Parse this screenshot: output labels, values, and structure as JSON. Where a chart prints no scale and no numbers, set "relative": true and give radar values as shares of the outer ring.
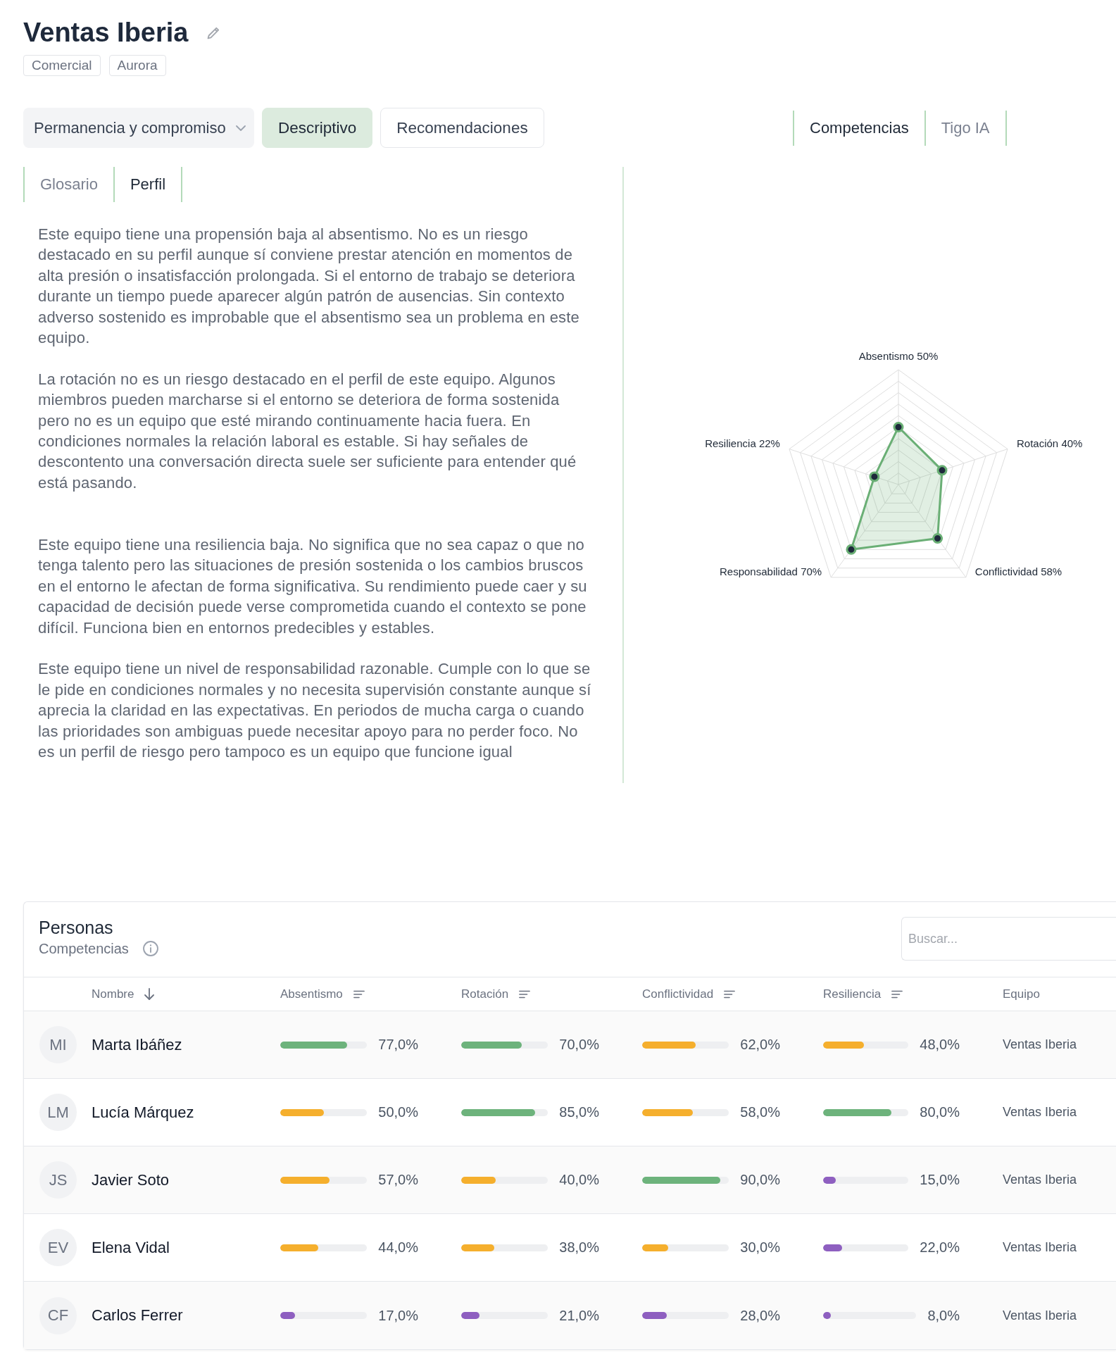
{
  "header": {
    "title": "Ventas Iberia",
    "tags": [
      "Comercial",
      "Aurora"
    ]
  },
  "toolbar": {
    "dropdown": {
      "value": "Permanencia y compromiso"
    },
    "view_buttons": [
      {
        "label": "Descriptivo",
        "selected": true
      },
      {
        "label": "Recomendaciones",
        "selected": false
      }
    ]
  },
  "right_tabs": [
    {
      "label": "Competencias",
      "selected": true
    },
    {
      "label": "Tigo IA",
      "selected": false
    }
  ],
  "sub_tabs": [
    {
      "label": "Glosario",
      "selected": false
    },
    {
      "label": "Perfil",
      "selected": true
    }
  ],
  "description": {
    "paragraphs": [
      "Este equipo tiene una propensión baja al absentismo. No es un riesgo destacado en su perfil aunque sí conviene prestar atención en momentos de alta presión o insatisfacción prolongada. Si el entorno de trabajo se deteriora durante un tiempo puede aparecer algún patrón de ausencias. Sin contexto adverso sostenido es improbable que el absentismo sea un problema en este equipo.",
      "La rotación no es un riesgo destacado en el perfil de este equipo. Algunos miembros pueden marcharse si el entorno se deteriora de forma sostenida pero no es un equipo que esté mirando continuamente hacia fuera. En condiciones normales la relación laboral es estable. Si hay señales de descontento una conversación directa suele ser suficiente para entender qué está pasando.",
      "Este equipo tiene una resiliencia baja. No significa que no sea capaz o que no tenga talento pero las situaciones de presión sostenida o los cambios bruscos en el entorno le afectan de forma significativa. Su rendimiento puede caer y su capacidad de decisión puede verse comprometida cuando el contexto se pone difícil. Funciona bien en entornos predecibles y estables.",
      "Este equipo tiene un nivel de responsabilidad razonable. Cumple con lo que se le pide en condiciones normales y no necesita supervisión constante aunque sí aprecia la claridad en las expectativas. En periodos de mucha carga o cuando las prioridades son ambiguas puede necesitar apoyo para no perder foco. No es un perfil de riesgo pero tampoco es un equipo que funcione igual"
    ]
  },
  "radar": {
    "chart_data": {
      "type": "radar",
      "categories": [
        "Absentismo",
        "Rotación",
        "Conflictividad",
        "Responsabilidad",
        "Resiliencia"
      ],
      "series": [
        {
          "color": "#6aaf75",
          "values": [
            0.5,
            0.4,
            0.58,
            0.7,
            0.22
          ]
        }
      ],
      "ylim": [
        0,
        1
      ],
      "relative": true,
      "value_labels": [
        "50%",
        "40%",
        "58%",
        "70%",
        "22%"
      ]
    }
  },
  "people": {
    "title": "Personas",
    "subtitle": "Competencias",
    "search": {
      "placeholder": "Buscar..."
    },
    "columns": [
      {
        "label": "Nombre",
        "kind": "sorted"
      },
      {
        "label": "Absentismo",
        "kind": "sortable"
      },
      {
        "label": "Rotación",
        "kind": "sortable"
      },
      {
        "label": "Conflictividad",
        "kind": "sortable"
      },
      {
        "label": "Resiliencia",
        "kind": "sortable"
      },
      {
        "label": "Equipo",
        "kind": "plain"
      }
    ],
    "rows": [
      {
        "initials": "MI",
        "name": "Marta Ibáñez",
        "metrics": [
          {
            "level": 0.77,
            "reading": "77,0%"
          },
          {
            "level": 0.7,
            "reading": "70,0%"
          },
          {
            "level": 0.62,
            "reading": "62,0%"
          },
          {
            "level": 0.48,
            "reading": "48,0%"
          }
        ],
        "team": "Ventas Iberia"
      },
      {
        "initials": "LM",
        "name": "Lucía Márquez",
        "metrics": [
          {
            "level": 0.5,
            "reading": "50,0%"
          },
          {
            "level": 0.85,
            "reading": "85,0%"
          },
          {
            "level": 0.58,
            "reading": "58,0%"
          },
          {
            "level": 0.8,
            "reading": "80,0%"
          }
        ],
        "team": "Ventas Iberia"
      },
      {
        "initials": "JS",
        "name": "Javier Soto",
        "metrics": [
          {
            "level": 0.57,
            "reading": "57,0%"
          },
          {
            "level": 0.4,
            "reading": "40,0%"
          },
          {
            "level": 0.9,
            "reading": "90,0%"
          },
          {
            "level": 0.15,
            "reading": "15,0%"
          }
        ],
        "team": "Ventas Iberia"
      },
      {
        "initials": "EV",
        "name": "Elena Vidal",
        "metrics": [
          {
            "level": 0.44,
            "reading": "44,0%"
          },
          {
            "level": 0.38,
            "reading": "38,0%"
          },
          {
            "level": 0.3,
            "reading": "30,0%"
          },
          {
            "level": 0.22,
            "reading": "22,0%"
          }
        ],
        "team": "Ventas Iberia"
      },
      {
        "initials": "CF",
        "name": "Carlos Ferrer",
        "metrics": [
          {
            "level": 0.17,
            "reading": "17,0%"
          },
          {
            "level": 0.21,
            "reading": "21,0%"
          },
          {
            "level": 0.28,
            "reading": "28,0%"
          },
          {
            "level": 0.08,
            "reading": "8,0%"
          }
        ],
        "team": "Ventas Iberia"
      }
    ]
  }
}
